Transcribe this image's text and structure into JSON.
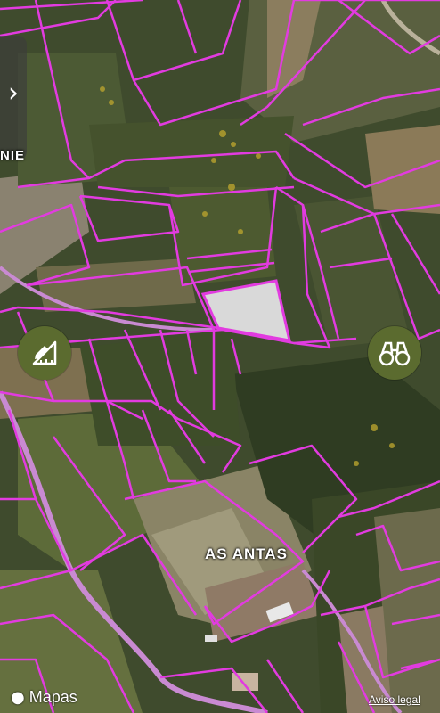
{
  "map": {
    "place_label": "AS ANTAS",
    "partial_label": "NIE",
    "attribution": "Mapas",
    "legal_link": "Aviso legal",
    "parcel_color": "#e23be0",
    "selected_fill": "#d9d9d9"
  },
  "controls": {
    "side_handle_glyph": "›",
    "edit_button_icon": "pencil-ruler-icon",
    "explore_button_icon": "binoculars-icon"
  }
}
